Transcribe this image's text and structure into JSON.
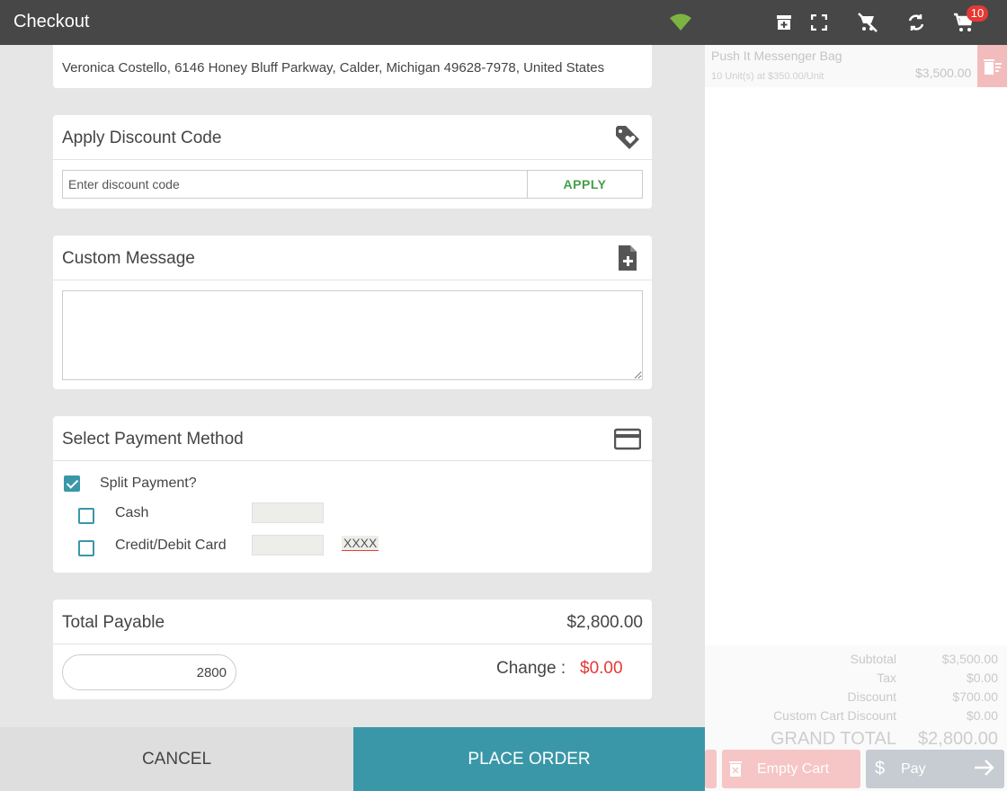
{
  "topbar": {
    "title": "Checkout",
    "cart_count": "10",
    "icons": [
      "wifi-icon",
      "add-box-icon",
      "fullscreen-icon",
      "remove-cart-icon",
      "sync-icon",
      "cart-icon"
    ]
  },
  "address": {
    "text": "Veronica Costello, 6146 Honey Bluff Parkway, Calder, Michigan 49628-7978, United States"
  },
  "discount": {
    "title": "Apply Discount Code",
    "placeholder": "Enter discount code",
    "apply_label": "APPLY"
  },
  "message": {
    "title": "Custom Message",
    "value": ""
  },
  "payment": {
    "title": "Select Payment Method",
    "split_label": "Split Payment?",
    "split_checked": true,
    "methods": [
      {
        "label": "Cash",
        "checked": false
      },
      {
        "label": "Credit/Debit Card",
        "checked": false,
        "extra": "XXXX"
      }
    ]
  },
  "total": {
    "label": "Total Payable",
    "amount": "$2,800.00",
    "input_value": "2800",
    "change_label": "Change :",
    "change_value": "$0.00"
  },
  "actions": {
    "cancel": "CANCEL",
    "place_order": "PLACE ORDER"
  },
  "cart": {
    "items": [
      {
        "name": "Push It Messenger Bag",
        "sub": "10 Unit(s) at $350.00/Unit",
        "price": "$3,500.00"
      }
    ],
    "summary": {
      "subtotal_label": "Subtotal",
      "subtotal": "$3,500.00",
      "tax_label": "Tax",
      "tax": "$0.00",
      "discount_label": "Discount",
      "discount": "$700.00",
      "custom_discount_label": "Custom Cart Discount",
      "custom_discount": "$0.00",
      "grand_label": "GRAND TOTAL",
      "grand": "$2,800.00"
    },
    "empty_label": "Empty Cart",
    "pay_label": "Pay"
  },
  "colors": {
    "topbar": "#474747",
    "accent": "#3a97a8",
    "apply": "#43a047",
    "danger": "#e53935"
  }
}
